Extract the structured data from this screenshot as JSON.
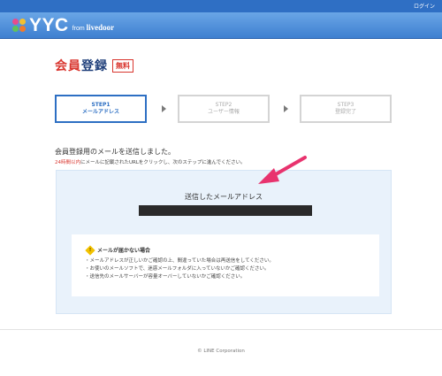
{
  "topbar": {
    "login_label": "ログイン"
  },
  "brand": {
    "logo_text": "YYC",
    "logo_sub_prefix": "from",
    "logo_sub_name": "livedoor"
  },
  "page": {
    "title_part1": "会員",
    "title_part2": "登録",
    "badge": "無料"
  },
  "steps": [
    {
      "number": "STEP1",
      "label": "メールアドレス",
      "active": true
    },
    {
      "number": "STEP2",
      "label": "ユーザー情報",
      "active": false
    },
    {
      "number": "STEP3",
      "label": "登録完了",
      "active": false
    }
  ],
  "messages": {
    "sent": "会員登録用のメールを送信しました。",
    "instruction_red": "24時間以内",
    "instruction_rest": "にメールに記載されたURLをクリックし、次のステップに進んでください。"
  },
  "panel": {
    "sent_address_label": "送信したメールアドレス",
    "email_value": ""
  },
  "notice": {
    "icon": "warning-icon",
    "title": "メールが届かない場合",
    "items": [
      "・メールアドレスが正しいかご確認の上、間違っていた場合は再送信をしてください。",
      "・お使いのメールソフトで、迷惑メールフォルダに入っていないかご確認ください。",
      "・送信先のメールサーバーが容量オーバーしていないかご確認ください。"
    ]
  },
  "footer": {
    "copyright": "© LINE Corporation"
  },
  "colors": {
    "brand_blue": "#2f6fc4",
    "accent_red": "#d9362f",
    "arrow_pink": "#e8336e"
  }
}
